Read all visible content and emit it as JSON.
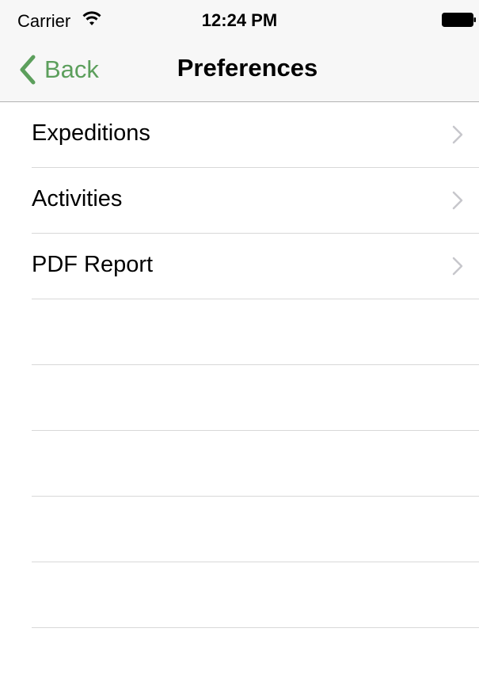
{
  "status_bar": {
    "carrier": "Carrier",
    "time": "12:24 PM",
    "wifi_icon": "wifi-icon",
    "battery_icon": "battery-full-icon"
  },
  "nav": {
    "back_label": "Back",
    "title": "Preferences",
    "accent_color": "#5c9f5c"
  },
  "menu": {
    "items": [
      {
        "label": "Expeditions"
      },
      {
        "label": "Activities"
      },
      {
        "label": "PDF Report"
      }
    ]
  }
}
